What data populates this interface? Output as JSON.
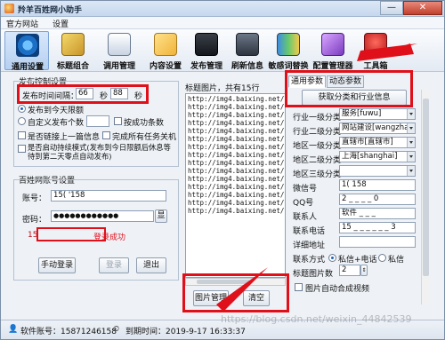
{
  "window": {
    "title": "羚羊百姓网小助手",
    "minimize": "—",
    "close": "✕"
  },
  "menu": [
    "官方网站",
    "设置"
  ],
  "toolbar": [
    {
      "label": "通用设置",
      "icon": "settings-gear-icon"
    },
    {
      "label": "标题组合",
      "icon": "title-combo-icon"
    },
    {
      "label": "调用管理",
      "icon": "call-manager-icon"
    },
    {
      "label": "内容设置",
      "icon": "content-settings-icon"
    },
    {
      "label": "发布管理",
      "icon": "publish-manager-icon"
    },
    {
      "label": "刷新信息",
      "icon": "refresh-info-icon"
    },
    {
      "label": "敏感词替换",
      "icon": "sensitive-word-icon"
    },
    {
      "label": "配置管理器",
      "icon": "config-manager-icon"
    },
    {
      "label": "工具箱",
      "icon": "toolbox-icon"
    }
  ],
  "publish_control": {
    "group_title": "发布控制设置",
    "interval_label": "发布时间间隔：",
    "interval_from": "66",
    "sep_label": "秒",
    "interval_to": "88",
    "unit_label": "秒",
    "radio_unlimited": "发布到今天限额",
    "radio_custom": "自定义发布个数",
    "custom_count": "",
    "by_success": "按成功条数",
    "check_continue": "是否链接上一篇信息",
    "check_shutdown": "完成所有任务关机",
    "check_start_task": "是否启动持续模式(发布到今日限额后休息等待到第二天零点自动发布)"
  },
  "account": {
    "group_title": "百姓网账号设置",
    "account_label": "账号：",
    "account_value": "15(    '158",
    "password_label": "密码：",
    "password_value": "●●●●●●●●●●●●",
    "show_button": "显",
    "status_id": "15",
    "status_text": "登录成功",
    "manual_login": "手动登录",
    "login": "登录",
    "logout": "退出"
  },
  "image_list": {
    "title": "标题图片，共有15行",
    "urls": [
      "http://img4.baixing.net/",
      "http://img4.baixing.net/",
      "http://img4.baixing.net/",
      "http://img4.baixing.net/",
      "http://img4.baixing.net/",
      "http://img4.baixing.net/",
      "http://img4.baixing.net/",
      "http://img4.baixing.net/",
      "http://img4.baixing.net/",
      "http://img4.baixing.net/",
      "http://img4.baixing.net/",
      "http://img4.baixing.net/",
      "http://img4.baixing.net/",
      "http://img4.baixing.net/",
      "http://img4.baixing.net/"
    ],
    "manage_button": "图片管理",
    "clear_button": "清空"
  },
  "params": {
    "tab_general": "通用参数",
    "tab_dynamic": "动态参数",
    "fetch_button": "获取分类和行业信息",
    "rows": [
      {
        "label": "行业一级分类",
        "value": "服务[fuwu]",
        "type": "select"
      },
      {
        "label": "行业二级分类",
        "value": "网站建设[wangzhanj",
        "type": "select"
      },
      {
        "label": "地区一级分类",
        "value": "直辖市[直辖市]",
        "type": "select"
      },
      {
        "label": "地区二级分类",
        "value": "上海[shanghai]",
        "type": "select"
      },
      {
        "label": "地区三级分类",
        "value": "",
        "type": "select"
      },
      {
        "label": "微信号",
        "value": "1(         158",
        "type": "input"
      },
      {
        "label": "QQ号",
        "value": "2  _ _ _ _ 0",
        "type": "input"
      },
      {
        "label": "联系人",
        "value": "软件  _ _ _",
        "type": "input"
      },
      {
        "label": "联系电话",
        "value": "15 _ _ _ _ _ _ 3",
        "type": "input"
      },
      {
        "label": "详细地址",
        "value": "",
        "type": "input"
      }
    ],
    "contact_label": "联系方式",
    "contact_private": "私信+电话",
    "contact_only": "私信",
    "img_count_label": "标题图片数",
    "img_count": "2",
    "auto_video": "图片自动合成视频"
  },
  "status": {
    "account_label": "软件账号：15871246158",
    "expire_label": "到期时间：2019-9-17 16:33:37"
  },
  "watermark": "https://blog.csdn.net/weixin_44842539"
}
